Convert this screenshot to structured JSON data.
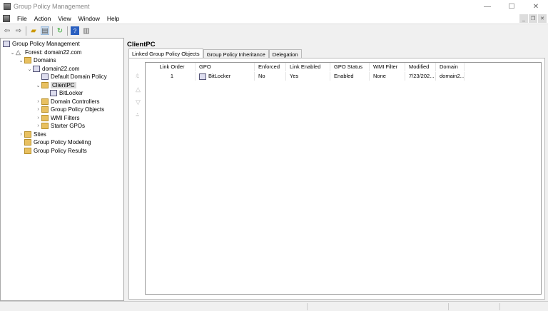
{
  "window": {
    "title": "Group Policy Management",
    "controls": [
      "—",
      "☐",
      "✕"
    ]
  },
  "menu": [
    "File",
    "Action",
    "View",
    "Window",
    "Help"
  ],
  "tree": [
    {
      "label": "Group Policy Management",
      "level": 0,
      "chev": "",
      "icon": "gpm"
    },
    {
      "label": "Forest: domain22.com",
      "level": 1,
      "chev": "⌄",
      "icon": "forest"
    },
    {
      "label": "Domains",
      "level": 2,
      "chev": "⌄",
      "icon": "folder"
    },
    {
      "label": "domain22.com",
      "level": 3,
      "chev": "⌄",
      "icon": "domain"
    },
    {
      "label": "Default Domain Policy",
      "level": 4,
      "chev": "",
      "icon": "gpo"
    },
    {
      "label": "ClientPC",
      "level": 4,
      "chev": "⌄",
      "icon": "folder",
      "selected": true
    },
    {
      "label": "BitLocker",
      "level": 5,
      "chev": "",
      "icon": "gpo"
    },
    {
      "label": "Domain Controllers",
      "level": 4,
      "chev": "›",
      "icon": "folder"
    },
    {
      "label": "Group Policy Objects",
      "level": 4,
      "chev": "›",
      "icon": "folder"
    },
    {
      "label": "WMI Filters",
      "level": 4,
      "chev": "›",
      "icon": "folder"
    },
    {
      "label": "Starter GPOs",
      "level": 4,
      "chev": "›",
      "icon": "folder"
    },
    {
      "label": "Sites",
      "level": 2,
      "chev": "›",
      "icon": "folder"
    },
    {
      "label": "Group Policy Modeling",
      "level": 2,
      "chev": "",
      "icon": "folder"
    },
    {
      "label": "Group Policy Results",
      "level": 2,
      "chev": "",
      "icon": "folder"
    }
  ],
  "detail": {
    "title": "ClientPC",
    "tabs": [
      "Linked Group Policy Objects",
      "Group Policy Inheritance",
      "Delegation"
    ],
    "columns": [
      "Link Order",
      "GPO",
      "Enforced",
      "Link Enabled",
      "GPO Status",
      "WMI Filter",
      "Modified",
      "Domain"
    ],
    "rows": [
      [
        "1",
        "BitLocker",
        "No",
        "Yes",
        "Enabled",
        "None",
        "7/23/202...",
        "domain2..."
      ]
    ]
  }
}
